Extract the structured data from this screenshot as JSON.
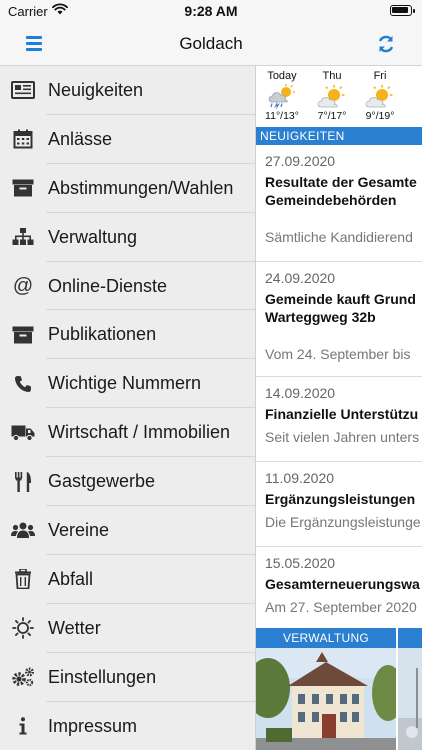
{
  "status_bar": {
    "carrier": "Carrier",
    "time": "9:28 AM"
  },
  "navbar": {
    "title": "Goldach"
  },
  "menu": [
    {
      "label": "Neuigkeiten",
      "icon": "newspaper-icon"
    },
    {
      "label": "Anlässe",
      "icon": "calendar-icon"
    },
    {
      "label": "Abstimmungen/Wahlen",
      "icon": "ballot-box-icon"
    },
    {
      "label": "Verwaltung",
      "icon": "org-chart-icon"
    },
    {
      "label": "Online-Dienste",
      "icon": "at-sign-icon"
    },
    {
      "label": "Publikationen",
      "icon": "archive-box-icon"
    },
    {
      "label": "Wichtige Nummern",
      "icon": "phone-icon"
    },
    {
      "label": "Wirtschaft / Immobilien",
      "icon": "truck-icon"
    },
    {
      "label": "Gastgewerbe",
      "icon": "fork-knife-icon"
    },
    {
      "label": "Vereine",
      "icon": "group-icon"
    },
    {
      "label": "Abfall",
      "icon": "trash-icon"
    },
    {
      "label": "Wetter",
      "icon": "sun-outline-icon"
    },
    {
      "label": "Einstellungen",
      "icon": "gears-icon"
    },
    {
      "label": "Impressum",
      "icon": "info-icon"
    }
  ],
  "weather": [
    {
      "day": "Today",
      "temp": "11°/13°",
      "icon": "sun-rain-cloud-icon"
    },
    {
      "day": "Thu",
      "temp": "7°/17°",
      "icon": "sun-cloud-icon"
    },
    {
      "day": "Fri",
      "temp": "9°/19°",
      "icon": "sun-cloud-icon"
    }
  ],
  "news_section": {
    "header": "NEUIGKEITEN"
  },
  "news": [
    {
      "date": "27.09.2020",
      "title_line1": "Resultate der Gesamte",
      "title_line2": "Gemeindebehörden",
      "teaser": "Sämtliche Kandidierend"
    },
    {
      "date": "24.09.2020",
      "title_line1": "Gemeinde kauft Grund",
      "title_line2": "Warteggweg 32b",
      "teaser": "Vom 24. September bis"
    },
    {
      "date": "14.09.2020",
      "title_line1": "Finanzielle Unterstützu",
      "title_line2": "",
      "teaser": "Seit vielen Jahren unters"
    },
    {
      "date": "11.09.2020",
      "title_line1": "Ergänzungsleistungen",
      "title_line2": "",
      "teaser": "Die Ergänzungsleistunge"
    },
    {
      "date": "15.05.2020",
      "title_line1": "Gesamterneuerungswa",
      "title_line2": "",
      "teaser": "Am 27. September 2020"
    }
  ],
  "tiles": [
    {
      "label": "VERWALTUNG"
    }
  ],
  "colors": {
    "accent": "#2b7fd0",
    "sidebar_bg": "#ededed",
    "bar_bg": "#f6f6f7"
  }
}
